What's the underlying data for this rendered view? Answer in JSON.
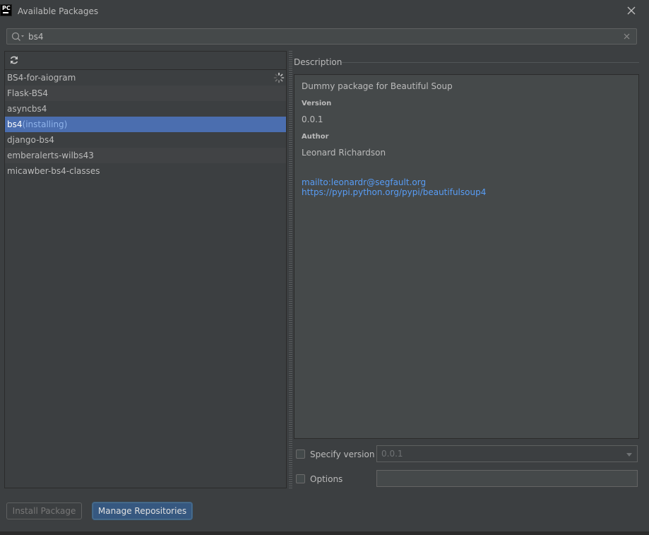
{
  "window": {
    "title": "Available Packages",
    "logo_text": "PC"
  },
  "search": {
    "value": "bs4",
    "placeholder": ""
  },
  "packages": [
    {
      "name": "BS4-for-aiogram",
      "status": ""
    },
    {
      "name": "Flask-BS4",
      "status": ""
    },
    {
      "name": "asyncbs4",
      "status": ""
    },
    {
      "name": "bs4",
      "status": "(installing)"
    },
    {
      "name": "django-bs4",
      "status": ""
    },
    {
      "name": "emberalerts-wilbs43",
      "status": ""
    },
    {
      "name": "micawber-bs4-classes",
      "status": ""
    }
  ],
  "description": {
    "header": "Description",
    "summary": "Dummy package for Beautiful Soup",
    "version_label": "Version",
    "version_value": "0.0.1",
    "author_label": "Author",
    "author_value": "Leonard Richardson",
    "links": [
      "mailto:leonardr@segfault.org",
      "https://pypi.python.org/pypi/beautifulsoup4"
    ]
  },
  "options": {
    "specify_version_label": "Specify version",
    "specify_version_value": "0.0.1",
    "specify_version_checked": false,
    "options_label": "Options",
    "options_value": "",
    "options_checked": false
  },
  "buttons": {
    "install": "Install Package",
    "manage": "Manage Repositories"
  },
  "colors": {
    "background": "#3c3f41",
    "selection": "#4b6eaf",
    "link": "#589df6",
    "status_text": "#8fb3ea"
  },
  "icons": [
    "app-logo-icon",
    "close-icon",
    "search-icon",
    "clear-icon",
    "refresh-icon",
    "spinner-icon"
  ]
}
